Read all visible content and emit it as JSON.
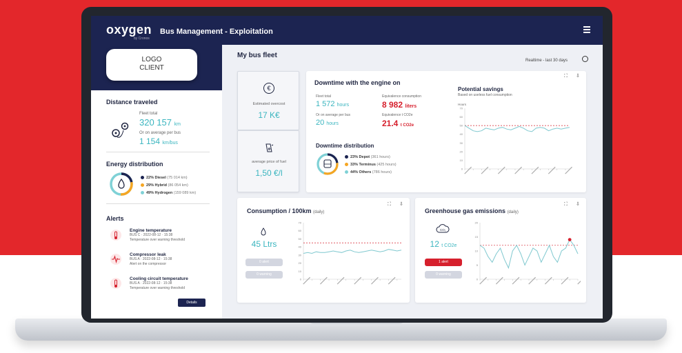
{
  "app": {
    "logo": "oxygen",
    "logo_sub": "by Cronos",
    "title": "Bus Management - Exploitation"
  },
  "logo_client": {
    "line1": "LOGO",
    "line2": "CLIENT"
  },
  "distance": {
    "title": "Distance traveled",
    "fleet_label": "Fleet total",
    "fleet_value": "320 157",
    "fleet_unit": "km",
    "avg_label": "Or on average per bus",
    "avg_value": "1 154",
    "avg_unit": "km/bus"
  },
  "energy": {
    "title": "Energy distribution",
    "items": [
      {
        "bold": "22% Diesel",
        "rest": "(75 014 km)",
        "color": "#1c2451"
      },
      {
        "bold": "29% Hybrid",
        "rest": "(86 054 km)",
        "color": "#f5a623"
      },
      {
        "bold": "49% Hydrogen",
        "rest": "(159 089 km)",
        "color": "#7fd1d6"
      }
    ]
  },
  "alerts": {
    "title": "Alerts",
    "items": [
      {
        "title": "Engine temperature",
        "meta": "BUS C · 2022-08-12 · 15:38",
        "desc": "Temperature over warning threshold"
      },
      {
        "title": "Compressor leak",
        "meta": "BUS A · 2022-08-12 · 15:38",
        "desc": "Alert on the compressor"
      },
      {
        "title": "Cooling circuit temperature",
        "meta": "BUS A · 2022-08-12 · 15:38",
        "desc": "Temperature over warning threshold"
      }
    ],
    "details_label": "Details"
  },
  "main": {
    "title": "My bus fleet",
    "realtime": "Realtime - last 30 days"
  },
  "kpi": {
    "overcost_label": "Estimated overcost",
    "overcost_value": "17 K€",
    "fuel_label": "average price of fuel",
    "fuel_value": "1,50 €/l"
  },
  "downtime": {
    "title": "Downtime with the engine on",
    "fleet_label": "Fleet total",
    "fleet_value": "1 572",
    "fleet_unit": "hours",
    "eq_label": "Equivalence consumption",
    "eq_value": "8 982",
    "eq_unit": "liters",
    "avg_label": "Or on average per bus",
    "avg_value": "20",
    "avg_unit": "hours",
    "co2_label": "Equivalence t CO2e",
    "co2_value": "21.4",
    "co2_unit": "t CO2e",
    "dist_title": "Downtime distribution",
    "dist_items": [
      {
        "bold": "23% Depot",
        "rest": "(361 hours)",
        "color": "#1c2451"
      },
      {
        "bold": "33% Terminus",
        "rest": "(425 hours)",
        "color": "#f5a623"
      },
      {
        "bold": "44% Others",
        "rest": "(786 hours)",
        "color": "#7fd1d6"
      }
    ]
  },
  "savings": {
    "title": "Potential savings",
    "subtitle": "Based on useless fuel consumption",
    "ylabel": "Hours"
  },
  "consumption": {
    "title": "Consumption / 100km",
    "daily": "(daily)",
    "value": "45 Ltrs",
    "alert_label": "0 alert",
    "warning_label": "0 warning"
  },
  "ghg": {
    "title": "Greenhouse gas emissions",
    "daily": "(daily)",
    "value": "12",
    "unit": "t CO2e",
    "alert_label": "1 alert",
    "warning_label": "0 warning"
  },
  "chart_data": [
    {
      "type": "line",
      "title": "Potential savings",
      "ylabel": "Hours",
      "ylim": [
        0,
        70
      ],
      "yticks": [
        0,
        10,
        20,
        30,
        40,
        50,
        60,
        70
      ],
      "threshold": 50,
      "series": [
        {
          "values": [
            50,
            47,
            44,
            43,
            44,
            47,
            46,
            45,
            47,
            48,
            46,
            45,
            47,
            49,
            47,
            44,
            43,
            47,
            48,
            47,
            44,
            46,
            47,
            46,
            47,
            48
          ]
        }
      ]
    },
    {
      "type": "line",
      "title": "Consumption / 100km",
      "ylim": [
        0,
        70
      ],
      "yticks": [
        0,
        10,
        20,
        30,
        40,
        50,
        60,
        70
      ],
      "threshold": 45,
      "series": [
        {
          "values": [
            32,
            33,
            32,
            34,
            33,
            33,
            34,
            35,
            34,
            33,
            35,
            36,
            34,
            33,
            34,
            35,
            36,
            35,
            34,
            35,
            37,
            36,
            35,
            36
          ]
        }
      ]
    },
    {
      "type": "line",
      "title": "Greenhouse gas emissions",
      "ylim": [
        0,
        20
      ],
      "yticks": [
        0,
        5,
        10,
        15,
        20
      ],
      "threshold": 12,
      "series": [
        {
          "values": [
            12,
            11,
            8,
            6,
            9,
            11,
            7,
            4,
            10,
            12,
            9,
            5,
            8,
            11,
            10,
            6,
            9,
            12,
            8,
            6,
            10,
            11,
            14,
            12,
            9
          ]
        }
      ]
    }
  ]
}
